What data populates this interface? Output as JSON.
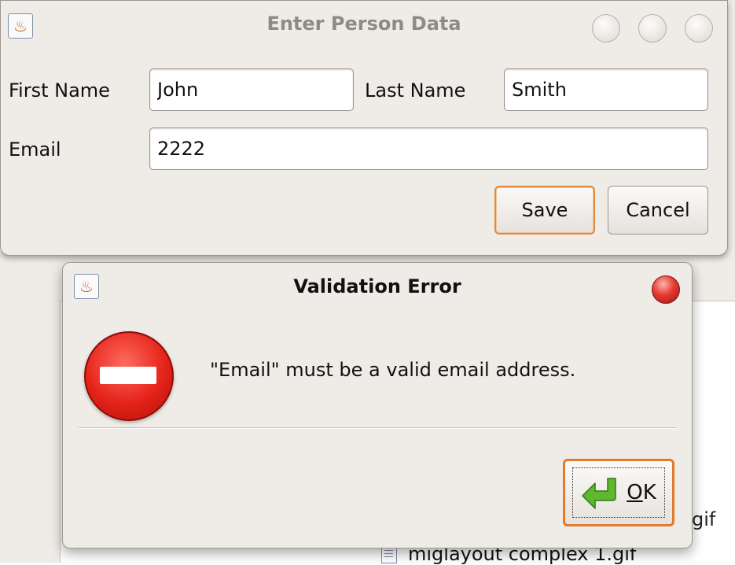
{
  "person_dialog": {
    "title": "Enter Person Data",
    "first_name_label": "First Name",
    "first_name_value": "John",
    "last_name_label": "Last Name",
    "last_name_value": "Smith",
    "email_label": "Email",
    "email_value": "2222",
    "save_label": "Save",
    "cancel_label": "Cancel"
  },
  "error_dialog": {
    "title": "Validation Error",
    "message": "\"Email\" must be a valid email address.",
    "ok_label_mnemonic": "O",
    "ok_label_rest": "K"
  },
  "background": {
    "file_label": "miglayout complex 1.gif",
    "fragment_gif": "gif"
  },
  "colors": {
    "default_button_border": "#e08a40",
    "ok_button_border": "#e47a2a",
    "error_icon": "#e5231a",
    "ok_arrow": "#5fb82e"
  },
  "icons": {
    "app": "java-cup-icon",
    "error": "stop-sign-icon",
    "ok": "enter-arrow-icon"
  }
}
